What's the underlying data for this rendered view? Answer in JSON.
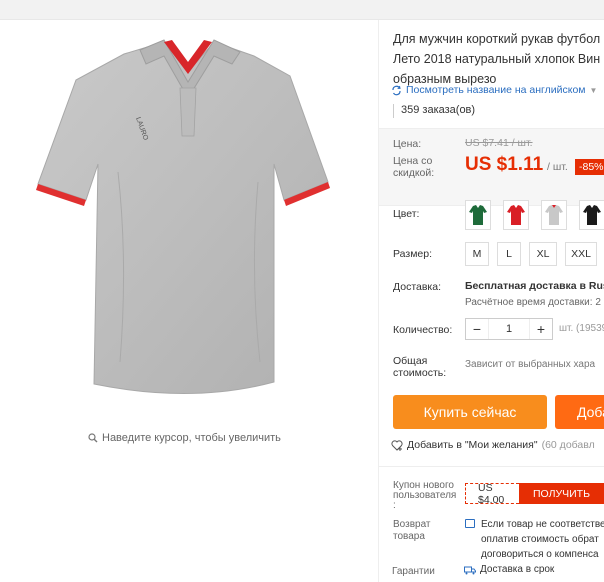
{
  "product": {
    "title_lines": [
      "Для мужчин короткий рукав футбол",
      "Лето 2018 натуральный хлопок Вин",
      "образным вырезо"
    ],
    "translate_link": "Посмотреть название на английском",
    "orders": "359 заказа(ов)",
    "zoom_hint": "Наведите курсор, чтобы увеличить"
  },
  "price": {
    "price_label": "Цена:",
    "old_price": "US $7.41 / шт.",
    "discount_label_line1": "Цена со",
    "discount_label_line2": "скидкой:",
    "new_price": "US $1.11",
    "unit": "/ шт.",
    "discount_badge": "-85%"
  },
  "options": {
    "color_label": "Цвет:",
    "colors": [
      {
        "name": "green",
        "hex": "#1e6b3a"
      },
      {
        "name": "red",
        "hex": "#d91f26"
      },
      {
        "name": "gray",
        "hex": "#c8c8c8"
      },
      {
        "name": "black",
        "hex": "#1a1a1a"
      }
    ],
    "size_label": "Размер:",
    "sizes": [
      "M",
      "L",
      "XL",
      "XXL"
    ]
  },
  "shipping": {
    "label": "Доставка:",
    "title": "Бесплатная доставка в Rus",
    "subtitle": "Расчётное время доставки: 2"
  },
  "quantity": {
    "label": "Количество:",
    "minus": "−",
    "value": "1",
    "plus": "+",
    "unit_note": "шт. (19539"
  },
  "total": {
    "label_line1": "Общая",
    "label_line2": "стоимость:",
    "note": "Зависит от выбранных хара"
  },
  "actions": {
    "buy_now": "Купить сейчас",
    "add_to_cart": "Доба",
    "wishlist": "Добавить в \"Мои желания\"",
    "wishlist_count": "(60 добавл"
  },
  "coupon": {
    "label_line1": "Купон нового",
    "label_line2": "пользователя",
    "label_line3": ":",
    "amount": "US $4.00",
    "get_button": "ПОЛУЧИТЬ"
  },
  "returns": {
    "label_line1": "Возврат",
    "label_line2": "товара",
    "text_lines": [
      "Если товар не соответстве",
      "оплатив стоимость обрат",
      "договориться о компенса"
    ]
  },
  "guarantee": {
    "label": "Гарантии",
    "text": "Доставка в срок"
  },
  "colors": {
    "accent_red": "#e62e04",
    "buy_orange": "#f88d1d",
    "cart_orange": "#ff6a13",
    "link_blue": "#2b6ec0"
  }
}
